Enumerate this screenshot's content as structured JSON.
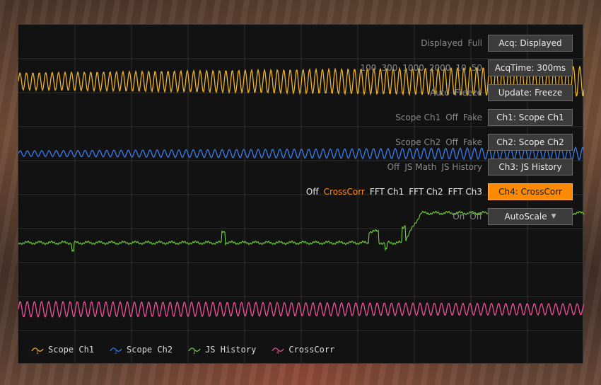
{
  "controls": [
    {
      "options": [
        "Displayed",
        "Full"
      ],
      "selected": "",
      "button": "Acq: Displayed"
    },
    {
      "options": [
        "100",
        "300",
        "1000",
        "2000",
        "10",
        "50"
      ],
      "selected": "",
      "button": "AcqTime: 300ms"
    },
    {
      "options": [
        "Auto",
        "Freeze"
      ],
      "selected": "",
      "button": "Update: Freeze"
    },
    {
      "options": [
        "Scope Ch1",
        "Off",
        "Fake"
      ],
      "selected": "",
      "button": "Ch1: Scope Ch1"
    },
    {
      "options": [
        "Scope Ch2",
        "Off",
        "Fake"
      ],
      "selected": "",
      "button": "Ch2: Scope Ch2"
    },
    {
      "options": [
        "Off",
        "JS Math",
        "JS History"
      ],
      "selected": "",
      "button": "Ch3: JS History"
    },
    {
      "options": [
        "Off",
        "CrossCorr",
        "FFT Ch1",
        "FFT Ch2",
        "FFT Ch3"
      ],
      "selected": "CrossCorr",
      "button": "Ch4: CrossCorr",
      "active": true
    },
    {
      "options": [
        "On",
        "Off"
      ],
      "selected": "",
      "button": "AutoScale"
    }
  ],
  "legend": [
    {
      "num": "1",
      "label": "Scope Ch1",
      "color": "#f0b429"
    },
    {
      "num": "2",
      "label": "Scope Ch2",
      "color": "#3a7bf0"
    },
    {
      "num": "3",
      "label": "JS History",
      "color": "#6fd23a"
    },
    {
      "num": "4",
      "label": "CrossCorr",
      "color": "#f0509a"
    }
  ]
}
